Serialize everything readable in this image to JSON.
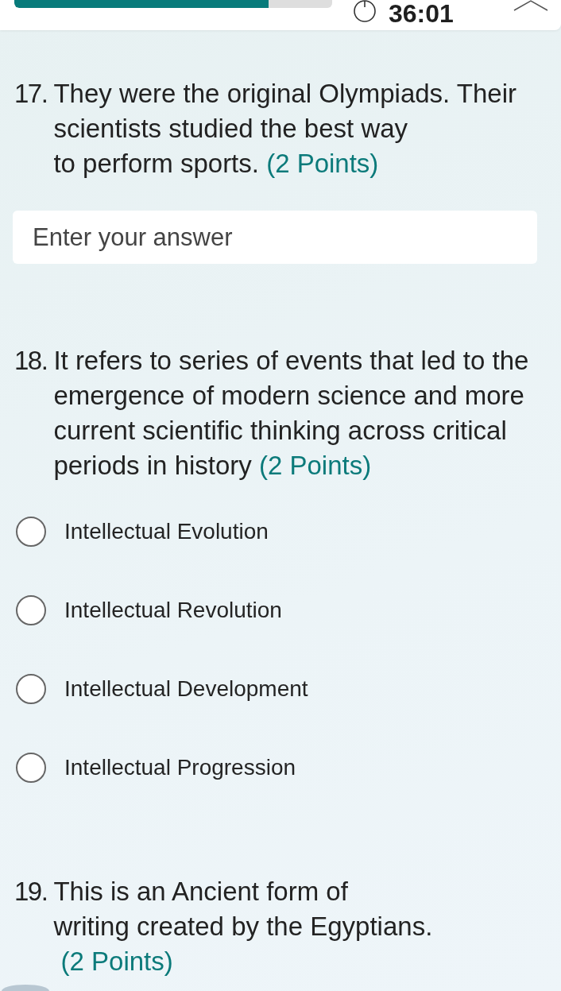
{
  "header": {
    "progress": {
      "level": 0.8
    },
    "timer": "36:01"
  },
  "questions": [
    {
      "number": "17.",
      "text": "They were the original Olympiads. Their\nscientists studied the best way\nto perform sports.",
      "points": "(2 Points)",
      "kind": "text",
      "answer": {
        "placeholder": "Enter your answer"
      }
    },
    {
      "number": "18.",
      "text": "It refers to series of events that led to the\nemergence of modern science and more\ncurrent scientific thinking across critical\nperiods in history",
      "points": "(2 Points)",
      "kind": "choice",
      "options": [
        {
          "label": "Intellectual Evolution",
          "selected": false
        },
        {
          "label": "Intellectual Revolution",
          "selected": false
        },
        {
          "label": "Intellectual Development",
          "selected": false
        },
        {
          "label": "Intellectual Progression",
          "selected": false
        }
      ]
    },
    {
      "number": "19.",
      "text": "This is an Ancient form of\nwriting created by the Egyptians.\n",
      "points": "(2 Points)"
    }
  ]
}
